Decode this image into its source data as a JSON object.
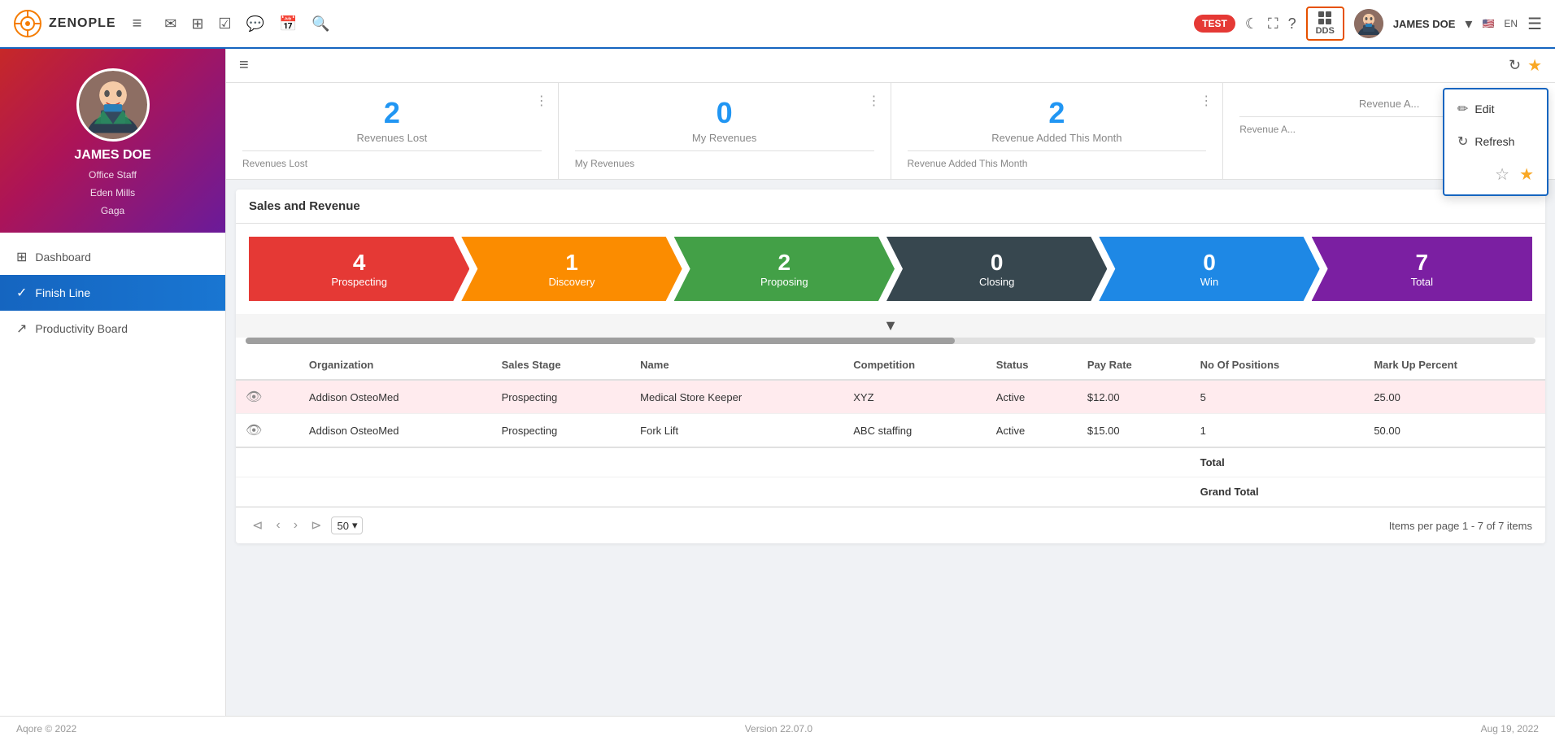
{
  "app": {
    "logo_text": "ZENOPLE",
    "test_badge": "TEST",
    "dds_label": "DDS",
    "user_name": "JAMES DOE",
    "language": "EN",
    "version": "Version 22.07.0",
    "copyright": "Aqore © 2022",
    "date": "Aug 19, 2022"
  },
  "sidebar": {
    "profile": {
      "name": "JAMES DOE",
      "role": "Office Staff",
      "location": "Eden Mills",
      "sub": "Gaga"
    },
    "items": [
      {
        "label": "Dashboard",
        "icon": "⊞",
        "active": false
      },
      {
        "label": "Finish Line",
        "icon": "✓",
        "active": true
      },
      {
        "label": "Productivity Board",
        "icon": "↗",
        "active": false
      }
    ]
  },
  "subheader": {
    "dropdown": {
      "edit_label": "Edit",
      "refresh_label": "Refresh"
    }
  },
  "stats": [
    {
      "number": "2",
      "title": "Revenues Lost",
      "footer": "Revenues Lost",
      "menu": "⋮"
    },
    {
      "number": "0",
      "title": "My Revenues",
      "footer": "My Revenues",
      "menu": "⋮"
    },
    {
      "number": "2",
      "title": "Revenue Added This Month",
      "footer": "Revenue Added This Month",
      "menu": "⋮"
    },
    {
      "number": "",
      "title": "Revenue A...",
      "footer": "Revenue A...",
      "menu": "⋮"
    }
  ],
  "sales": {
    "section_title": "Sales and Revenue",
    "pipeline": [
      {
        "number": "4",
        "label": "Prospecting",
        "color": "p-red"
      },
      {
        "number": "1",
        "label": "Discovery",
        "color": "p-orange"
      },
      {
        "number": "2",
        "label": "Proposing",
        "color": "p-green"
      },
      {
        "number": "0",
        "label": "Closing",
        "color": "p-dark"
      },
      {
        "number": "0",
        "label": "Win",
        "color": "p-blue"
      },
      {
        "number": "7",
        "label": "Total",
        "color": "p-purple"
      }
    ],
    "table": {
      "columns": [
        "",
        "Organization",
        "Sales Stage",
        "Name",
        "Competition",
        "Status",
        "Pay Rate",
        "No Of Positions",
        "Mark Up Percent"
      ],
      "rows": [
        {
          "org": "Addison OsteoMed",
          "stage": "Prospecting",
          "name": "Medical Store Keeper",
          "competition": "XYZ",
          "status": "Active",
          "pay_rate": "$12.00",
          "positions": "5",
          "markup": "25.00",
          "highlight": true
        },
        {
          "org": "Addison OsteoMed",
          "stage": "Prospecting",
          "name": "Fork Lift",
          "competition": "ABC staffing",
          "status": "Active",
          "pay_rate": "$15.00",
          "positions": "1",
          "markup": "50.00",
          "highlight": false
        }
      ],
      "total_label": "Total",
      "grand_total_label": "Grand Total"
    },
    "pagination": {
      "per_page": "50",
      "info": "Items per page   1 - 7 of 7 items"
    }
  }
}
